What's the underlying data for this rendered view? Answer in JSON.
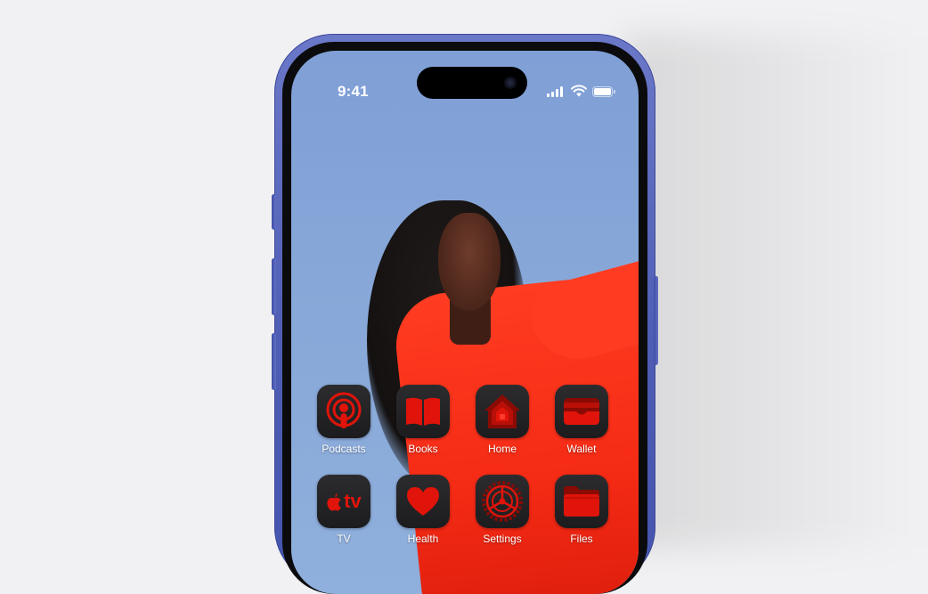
{
  "status_bar": {
    "time": "9:41",
    "signal_icon": "cellular-signal-icon",
    "wifi_icon": "wifi-icon",
    "battery_icon": "battery-icon"
  },
  "apps": [
    {
      "label": "Podcasts",
      "icon": "podcasts-icon"
    },
    {
      "label": "Books",
      "icon": "books-icon"
    },
    {
      "label": "Home",
      "icon": "home-icon"
    },
    {
      "label": "Wallet",
      "icon": "wallet-icon"
    },
    {
      "label": "TV",
      "icon": "tv-icon",
      "icon_text": "tv"
    },
    {
      "label": "Health",
      "icon": "health-icon"
    },
    {
      "label": "Settings",
      "icon": "settings-icon"
    },
    {
      "label": "Files",
      "icon": "files-icon"
    }
  ],
  "colors": {
    "icon_tint": "#e0140a",
    "icon_background": "#1c1c1e",
    "phone_frame": "#5564b8",
    "page_background": "#f1f1f3"
  }
}
